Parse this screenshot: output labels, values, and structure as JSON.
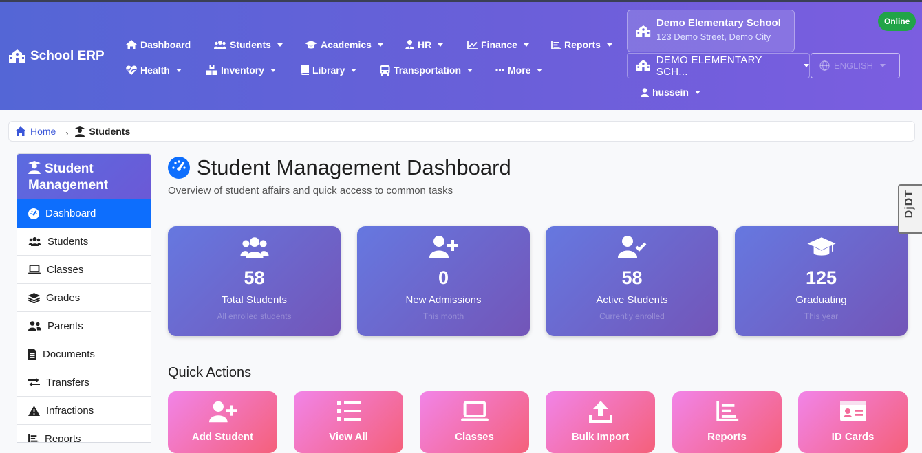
{
  "brand": {
    "name": "School ERP"
  },
  "nav": {
    "row1": [
      {
        "label": "Dashboard",
        "icon": "home-icon",
        "dropdown": false
      },
      {
        "label": "Students",
        "icon": "users-icon",
        "dropdown": true
      },
      {
        "label": "Academics",
        "icon": "graduation-cap-icon",
        "dropdown": true
      },
      {
        "label": "HR",
        "icon": "user-tie-icon",
        "dropdown": true
      },
      {
        "label": "Finance",
        "icon": "chart-line-icon",
        "dropdown": true
      },
      {
        "label": "Reports",
        "icon": "list-icon",
        "dropdown": true
      }
    ],
    "row2": [
      {
        "label": "Health",
        "icon": "heartbeat-icon",
        "dropdown": true
      },
      {
        "label": "Inventory",
        "icon": "boxes-icon",
        "dropdown": true
      },
      {
        "label": "Library",
        "icon": "book-icon",
        "dropdown": true
      },
      {
        "label": "Transportation",
        "icon": "bus-icon",
        "dropdown": true
      },
      {
        "label": "More",
        "icon": "ellipsis-icon",
        "dropdown": true
      }
    ]
  },
  "school": {
    "name": "Demo Elementary School",
    "address": "123 Demo Street, Demo City",
    "selector_value": "DEMO ELEMENTARY SCH..."
  },
  "status": {
    "online": "Online"
  },
  "language": {
    "value": "ENGLISH"
  },
  "user": {
    "name": "hussein"
  },
  "breadcrumb": {
    "home": "Home",
    "current": "Students"
  },
  "sidebar": {
    "title_line1": "Student",
    "title_line2": "Management",
    "items": [
      {
        "label": "Dashboard",
        "icon": "gauge-icon",
        "active": true
      },
      {
        "label": "Students",
        "icon": "users-icon",
        "active": false
      },
      {
        "label": "Classes",
        "icon": "laptop-icon",
        "active": false
      },
      {
        "label": "Grades",
        "icon": "layers-icon",
        "active": false
      },
      {
        "label": "Parents",
        "icon": "user-friends-icon",
        "active": false
      },
      {
        "label": "Documents",
        "icon": "file-icon",
        "active": false
      },
      {
        "label": "Transfers",
        "icon": "exchange-icon",
        "active": false
      },
      {
        "label": "Infractions",
        "icon": "warning-icon",
        "active": false
      },
      {
        "label": "Reports",
        "icon": "chart-bar-icon",
        "active": false
      }
    ]
  },
  "page": {
    "title": "Student Management Dashboard",
    "subtitle": "Overview of student affairs and quick access to common tasks"
  },
  "stats": [
    {
      "value": "58",
      "label": "Total Students",
      "sub": "All enrolled students",
      "icon": "users-icon"
    },
    {
      "value": "0",
      "label": "New Admissions",
      "sub": "This month",
      "icon": "user-plus-icon"
    },
    {
      "value": "58",
      "label": "Active Students",
      "sub": "Currently enrolled",
      "icon": "user-check-icon"
    },
    {
      "value": "125",
      "label": "Graduating",
      "sub": "This year",
      "icon": "graduation-cap-icon"
    }
  ],
  "quick_actions": {
    "title": "Quick Actions",
    "items": [
      {
        "label": "Add Student",
        "icon": "user-plus-icon"
      },
      {
        "label": "View All",
        "icon": "list-icon"
      },
      {
        "label": "Classes",
        "icon": "laptop-icon"
      },
      {
        "label": "Bulk Import",
        "icon": "upload-icon"
      },
      {
        "label": "Reports",
        "icon": "chart-bar-icon"
      },
      {
        "label": "ID Cards",
        "icon": "id-card-icon"
      }
    ]
  },
  "debug_toolbar": {
    "label": "DjDT"
  },
  "colors": {
    "nav_gradient_start": "#5466d6",
    "nav_gradient_end": "#7b5ee0",
    "sidebar_active": "#0d6efd",
    "online_badge": "#21a447",
    "stat_card_start": "#6678e0",
    "stat_card_end": "#7355b8",
    "action_card_start": "#f284e8",
    "action_card_end": "#f4607a"
  }
}
